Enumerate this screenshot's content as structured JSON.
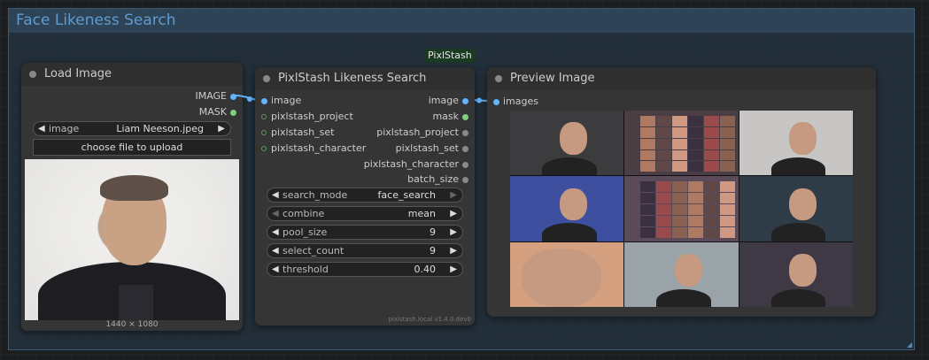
{
  "group": {
    "title": "Face Likeness Search"
  },
  "badge": {
    "label": "PixlStash"
  },
  "load_image": {
    "title": "Load Image",
    "outputs": [
      "IMAGE",
      "MASK"
    ],
    "image_widget": {
      "label": "image",
      "value": "Liam Neeson.jpeg"
    },
    "upload_label": "choose file to upload",
    "dimensions": "1440 × 1080"
  },
  "search": {
    "title": "PixlStash Likeness Search",
    "inputs": [
      "image",
      "pixlstash_project",
      "pixlstash_set",
      "pixlstash_character"
    ],
    "outputs": [
      "image",
      "mask",
      "pixlstash_project",
      "pixlstash_set",
      "pixlstash_character",
      "batch_size"
    ],
    "widgets": [
      {
        "label": "search_mode",
        "value": "face_search"
      },
      {
        "label": "combine",
        "value": "mean"
      },
      {
        "label": "pool_size",
        "value": "9"
      },
      {
        "label": "select_count",
        "value": "9"
      },
      {
        "label": "threshold",
        "value": "0.40"
      }
    ],
    "version": "pixlstash.local  v1.4.0.dev0"
  },
  "preview": {
    "title": "Preview Image",
    "inputs": [
      "images"
    ],
    "thumb_colors": [
      "#3c3c3e",
      "#4a3d44",
      "#c7c6c4",
      "#3f4fa0",
      "#5a4a5a",
      "#2f3c48",
      "#d4a080",
      "#9aa4a8",
      "#3e3944"
    ]
  },
  "colors": {
    "accent_blue": "#63b4ff",
    "group_title": "#5f9bd0",
    "mask_green": "#7ed07e"
  }
}
